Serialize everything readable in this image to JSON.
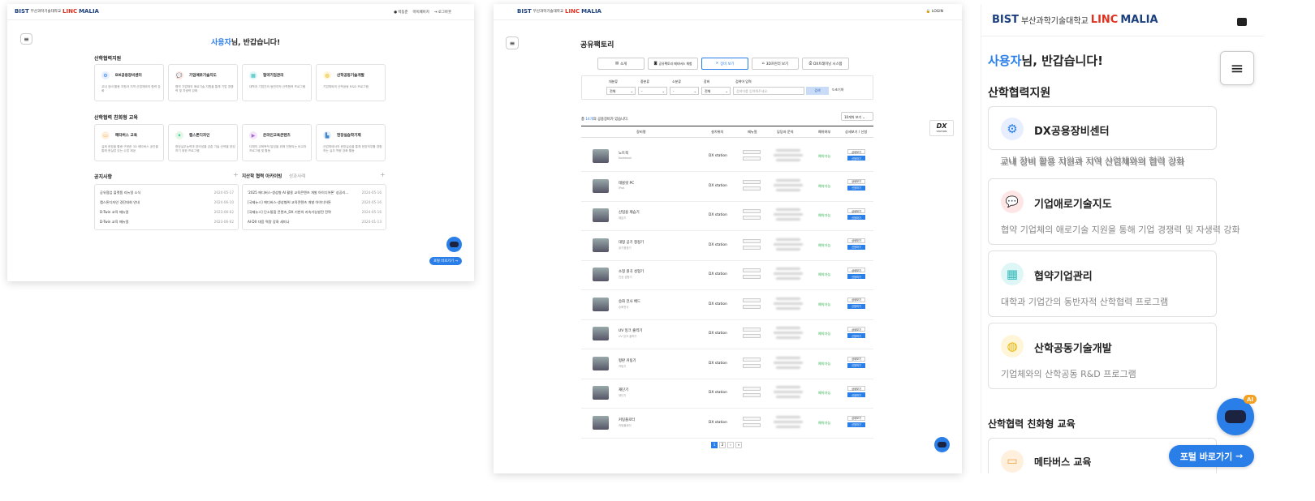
{
  "p1": {
    "logo": {
      "b": "BIST",
      "ko": "부산과학기술대학교",
      "linc": "LINC",
      "malia": "MALIA"
    },
    "user_links": [
      "박동준",
      "마이페이지",
      "로그아웃"
    ],
    "welcome": {
      "name": "사용자",
      "rest": "님, 반갑습니다!"
    },
    "sec1": "산학협력지원",
    "cards1": [
      {
        "title": "DX공용장비센터",
        "desc": "교내 장비 활용 지원과 지역 산업체와의 협력 강화"
      },
      {
        "title": "기업애로기술지도",
        "desc": "협약 기업체의 애로기술 지원을 통해 기업 경쟁력 및 자생력 강화"
      },
      {
        "title": "협약기업관리",
        "desc": "대학과 기업간의 동반자적 산학협력 프로그램"
      },
      {
        "title": "산학공동기술개발",
        "desc": "기업체와의 산학공동 R&D 프로그램"
      }
    ],
    "sec2": "산학협력 친화형 교육",
    "cards2": [
      {
        "title": "메타버스 교육",
        "desc": "실제 현장을 활용·구현한 3D 메타버스 공간을 통해 현실감 있는 수업 제공"
      },
      {
        "title": "캡스톤디자인",
        "desc": "현장실무능력과 창의성을 갖춘 기술 인력을 양성하기 위한 프로그램"
      },
      {
        "title": "온라인교육콘텐츠",
        "desc": "다채의 교육목적 달성을 위해 전형되는 비교과 프로그램 및 활동"
      },
      {
        "title": "현장실습학기제",
        "desc": "산업체에서의 현장실습을 통해 현장적무를 경험하는 실무 역량 강화 활동"
      }
    ],
    "notice_title": "공지사항",
    "notices": [
      {
        "t": "공유협업 플랫폼 리뉴얼 소식",
        "d": "2024-05-17"
      },
      {
        "t": "캡스톤디자인 경진대회 안내",
        "d": "2024-06-10"
      },
      {
        "t": "D-Twin 교육 매뉴얼",
        "d": "2023-06-02"
      },
      {
        "t": "D-Twin 교육 매뉴얼",
        "d": "2023-06-02"
      }
    ],
    "archive_tab1": "지산학 협력 아카이빙",
    "archive_tab2": "성과사례",
    "archives": [
      {
        "t": "'2025 에디버스-생성형 AI 활용 교육콘텐츠 개발 아이디어톤' 성공리...",
        "d": "2024-05-16"
      },
      {
        "t": "[국제뉴스] 에디버스-생성형AI 교육콘텐츠 개발 아이디어톤",
        "d": "2024-05-16"
      },
      {
        "t": "[국제뉴스] 단소통합 콘텐츠_DX 기반의 지속가능발전 전략",
        "d": "2024-05-16"
      },
      {
        "t": "AI·DX 대응 역량 강화 세미나",
        "d": "2024-01-13"
      }
    ],
    "portal_btn": "포털 바로가기"
  },
  "p2": {
    "login": "LOGIN",
    "title": "공유팩토리",
    "tabs": [
      "소개",
      "공유팩토리 메타버스 체험",
      "장비 보기",
      "3D프린터 보기",
      "DX트레이닝 시스템"
    ],
    "filters": {
      "labels": [
        "대분류",
        "중분류",
        "소분류",
        "장비",
        "검색어 입력"
      ],
      "values": [
        "전체",
        "-",
        "-",
        "전체"
      ],
      "placeholder": "검색어를 입력해주세요.",
      "search": "검색",
      "reset": "초기화"
    },
    "count": {
      "pre": "총 ",
      "n": "14개",
      "post": "의 공용장비가 있습니다."
    },
    "per_page": "10개씩 보기",
    "cols": [
      "장비명",
      "설치위치",
      "매뉴얼",
      "담당자 문의",
      "예약여부",
      "상세보기 / 신청"
    ],
    "loc": "DX station",
    "manual": [
      "장비매뉴얼",
      "운영매뉴얼"
    ],
    "status": "예약가능",
    "detail": "상세보기",
    "apply": "신청하기",
    "rows": [
      {
        "n": "노트북",
        "s": "Notebook"
      },
      {
        "n": "태블릿 PC",
        "s": "iPad"
      },
      {
        "n": "산업용 제습기",
        "s": "제습기"
      },
      {
        "n": "대형 공기 청정기",
        "s": "공기청정기"
      },
      {
        "n": "소형 원곡 성형기",
        "s": "진공 성형기"
      },
      {
        "n": "승화 전사 배드",
        "s": "승화전사"
      },
      {
        "n": "UV 잉크 출력기",
        "s": "UV 잉크 출력기"
      },
      {
        "n": "평판 커팅기",
        "s": "커팅기"
      },
      {
        "n": "재단기",
        "s": "재단기"
      },
      {
        "n": "커팅플로터",
        "s": "커팅플로터"
      }
    ],
    "pages": [
      "1",
      "2",
      "›",
      "»"
    ],
    "dx_badge": "DX",
    "dx_badge_sub": "STATION"
  },
  "p3": {
    "logo": {
      "b": "BIST",
      "ko": "부산과학기술대학교",
      "linc": "LINC",
      "malia": "MALIA"
    },
    "welcome": {
      "name": "사용자",
      "rest": "님, 반갑습니다!"
    },
    "sec1": "산학협력지원",
    "cards": [
      {
        "title": "DX공용장비센터",
        "desc": "교내 장비 활용 지원과 지역 산업체와의 협력 강화"
      },
      {
        "title": "기업애로기술지도",
        "desc": "협약 기업체의 애로기술 지원을 통해 기업 경쟁력 및 자생력 강화"
      },
      {
        "title": "협약기업관리",
        "desc": "대학과 기업간의 동반자적 산학협력 프로그램"
      },
      {
        "title": "산학공동기술개발",
        "desc": "기업체와의 산학공동 R&D 프로그램"
      }
    ],
    "sec2": "산학협력 친화형 교육",
    "card5": "메타버스 교육",
    "portal_btn": "포털 바로가기",
    "ai": "AI"
  },
  "colors": {
    "accent": "#2a7ee8",
    "brand": "#1c3f7d",
    "green": "#2bb24c"
  }
}
